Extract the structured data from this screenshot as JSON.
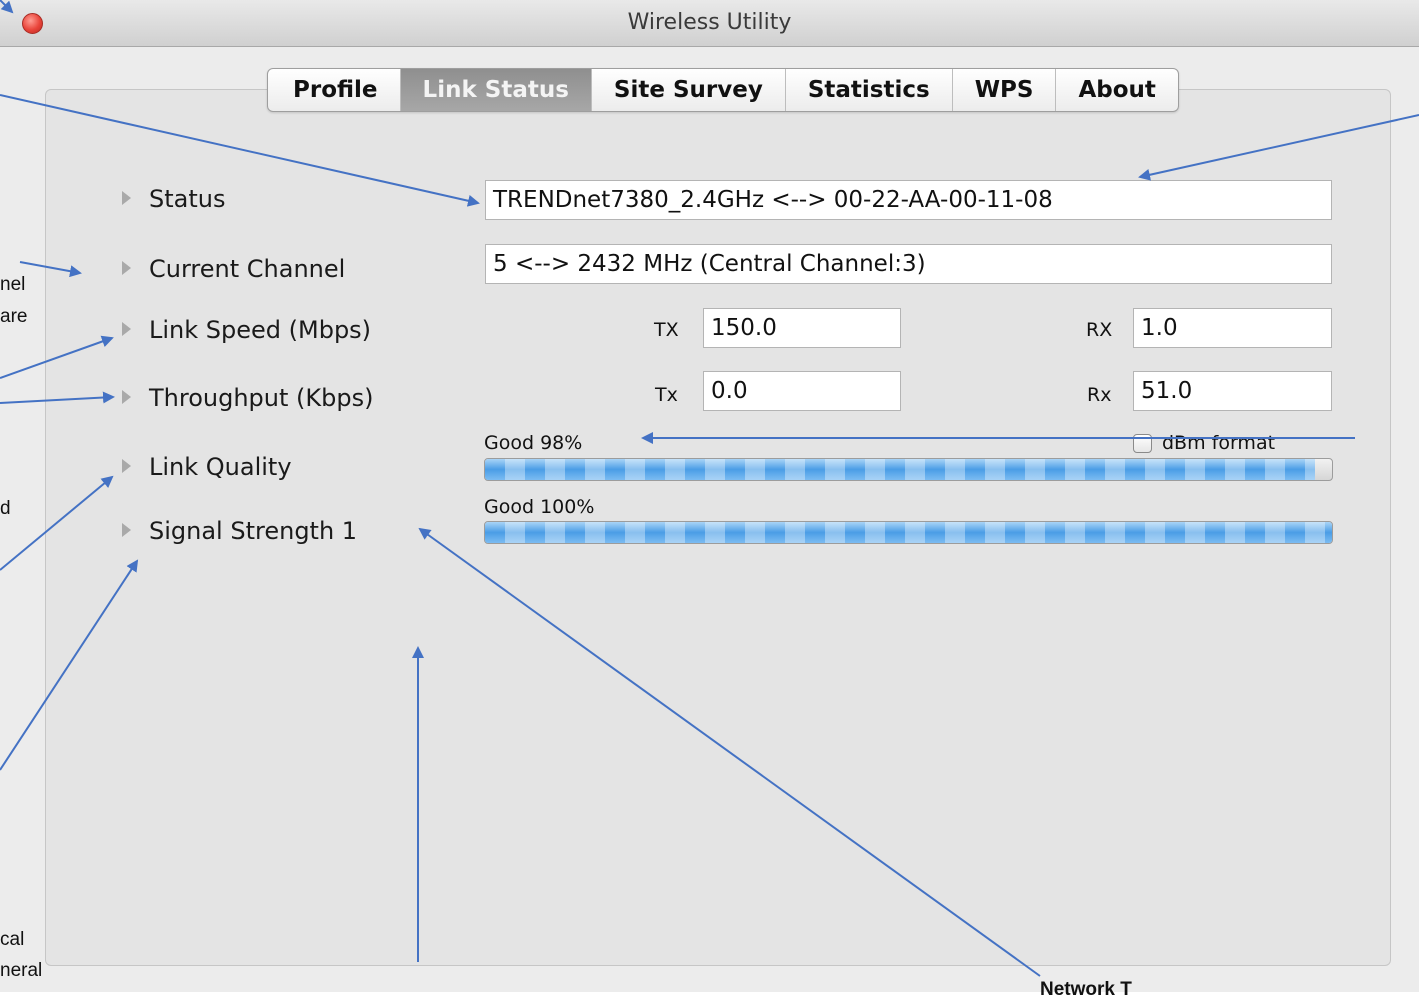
{
  "window": {
    "title": "Wireless Utility"
  },
  "tabs": [
    {
      "label": "Profile"
    },
    {
      "label": "Link Status"
    },
    {
      "label": "Site Survey"
    },
    {
      "label": "Statistics"
    },
    {
      "label": "WPS"
    },
    {
      "label": "About"
    }
  ],
  "active_tab": "Link Status",
  "rows": {
    "status": {
      "label": "Status",
      "value": "TRENDnet7380_2.4GHz <--> 00-22-AA-00-11-08"
    },
    "channel": {
      "label": "Current Channel",
      "value": "5 <--> 2432 MHz (Central Channel:3)"
    },
    "link_speed": {
      "label": "Link Speed (Mbps)",
      "tx_label": "TX",
      "tx_value": "150.0",
      "rx_label": "RX",
      "rx_value": "1.0"
    },
    "throughput": {
      "label": "Throughput (Kbps)",
      "tx_label": "Tx",
      "tx_value": "0.0",
      "rx_label": "Rx",
      "rx_value": "51.0"
    },
    "link_quality": {
      "label": "Link Quality",
      "text": "Good 98%",
      "percent": 98
    },
    "signal_strength": {
      "label": "Signal Strength 1",
      "text": "Good 100%",
      "percent": 100
    }
  },
  "dbm": {
    "label": "dBm format",
    "checked": false
  },
  "annotations": {
    "cut_texts": [
      "nel",
      "are",
      "d",
      "cal",
      "neral",
      "Network T"
    ]
  },
  "colors": {
    "accent": "#4a9de6",
    "arrow": "#4472c4"
  }
}
